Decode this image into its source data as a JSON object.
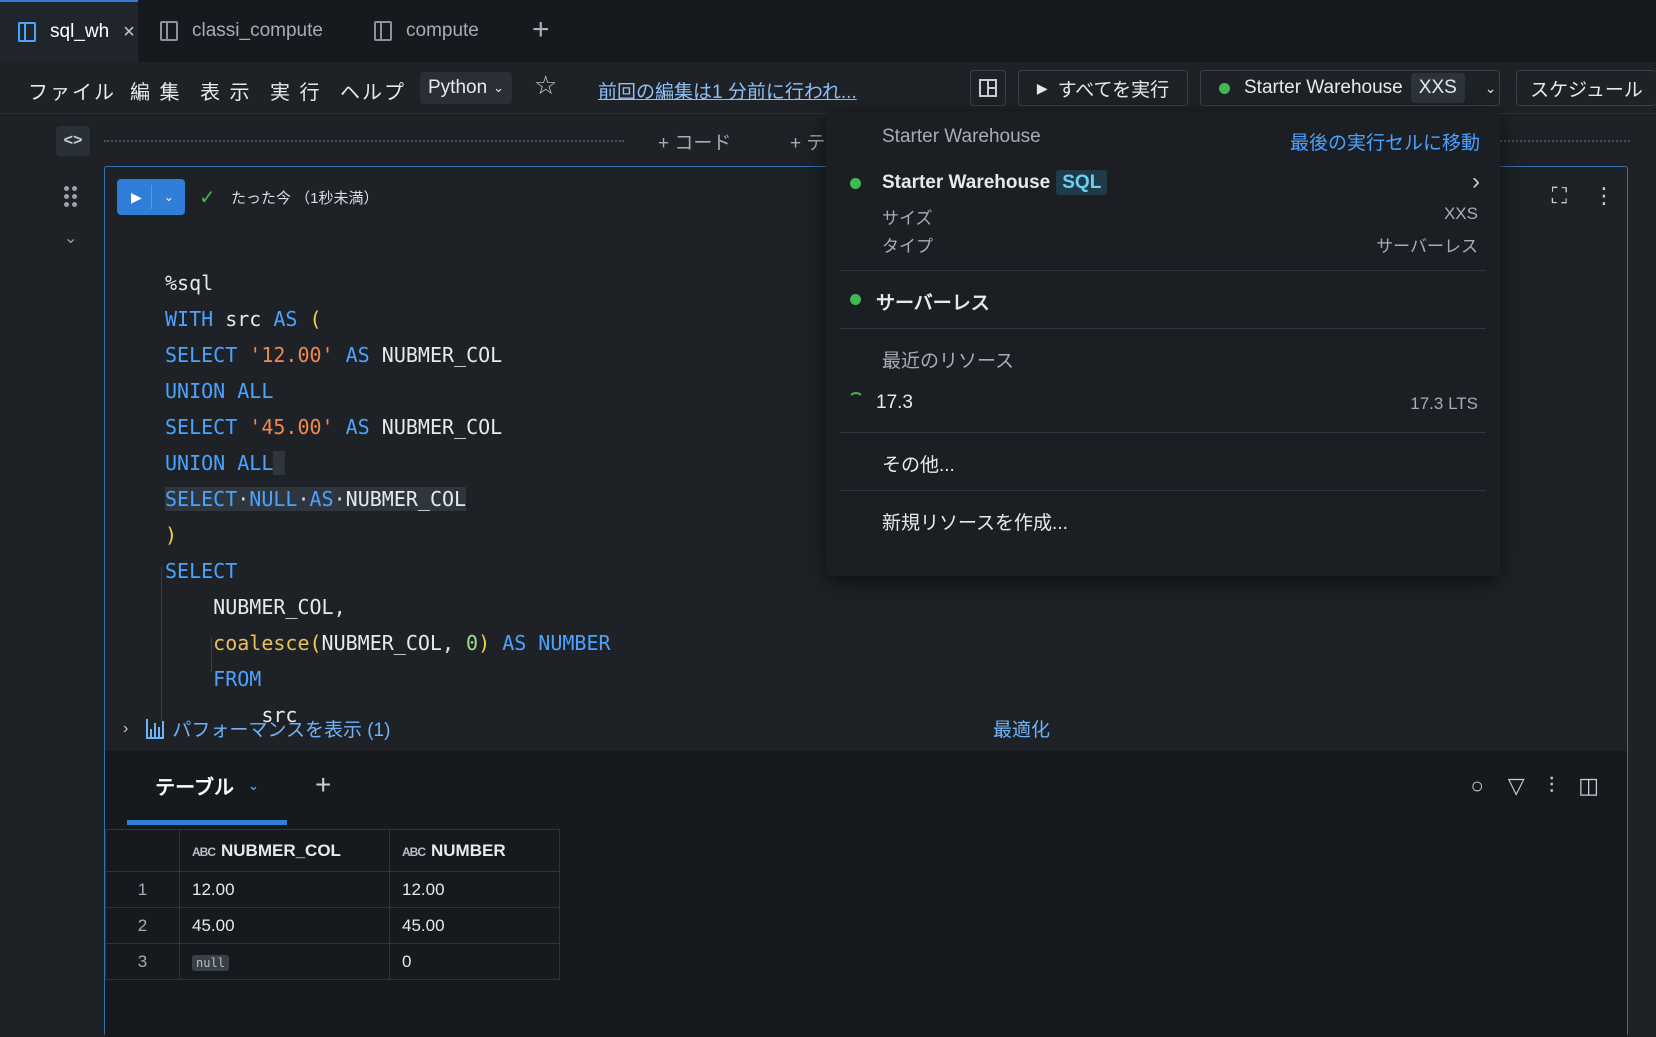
{
  "tabs": [
    {
      "label": "sql_wh",
      "active": true
    },
    {
      "label": "classi_compute",
      "active": false
    },
    {
      "label": "compute",
      "active": false
    }
  ],
  "menu": [
    "ファイル",
    "編 集",
    "表 示",
    "実 行",
    "ヘルプ"
  ],
  "language": "Python",
  "last_edit": "前回の編集は1 分前に行われ...",
  "run_all_label": "すべてを実行",
  "compute": {
    "name": "Starter Warehouse",
    "size": "XXS",
    "status_color": "#3fb950"
  },
  "schedule_label": "スケジュール",
  "add_code": "+ コード",
  "add_text": "+ テ",
  "cell": {
    "status": "たった今 （1秒未満）",
    "code_lines": [
      "%sql",
      "WITH src AS (",
      "SELECT '12.00' AS NUBMER_COL",
      "UNION ALL",
      "SELECT '45.00' AS NUBMER_COL",
      "UNION ALL",
      "SELECT NULL AS NUBMER_COL",
      ")",
      "SELECT",
      "NUBMER_COL,",
      "coalesce(NUBMER_COL, 0) AS NUMBER",
      "FROM",
      "src"
    ],
    "performance": "パフォーマンスを表示 (1)",
    "optimize": "最適化"
  },
  "result": {
    "tab_label": "テーブル",
    "columns": [
      "NUBMER_COL",
      "NUMBER"
    ],
    "type_icon": "ABC",
    "rows": [
      [
        "1",
        "12.00",
        "12.00"
      ],
      [
        "2",
        "45.00",
        "45.00"
      ],
      [
        "3",
        "null",
        "0"
      ]
    ]
  },
  "dropdown": {
    "header": "Starter Warehouse",
    "jump_link": "最後の実行セルに移動",
    "current": {
      "name": "Starter Warehouse",
      "badge": "SQL",
      "size_label": "サイズ",
      "size_value": "XXS",
      "type_label": "タイプ",
      "type_value": "サーバーレス"
    },
    "serverless": "サーバーレス",
    "recent_label": "最近のリソース",
    "recent": {
      "name": "17.3",
      "detail": "17.3 LTS"
    },
    "other": "その他...",
    "create": "新規リソースを作成..."
  }
}
